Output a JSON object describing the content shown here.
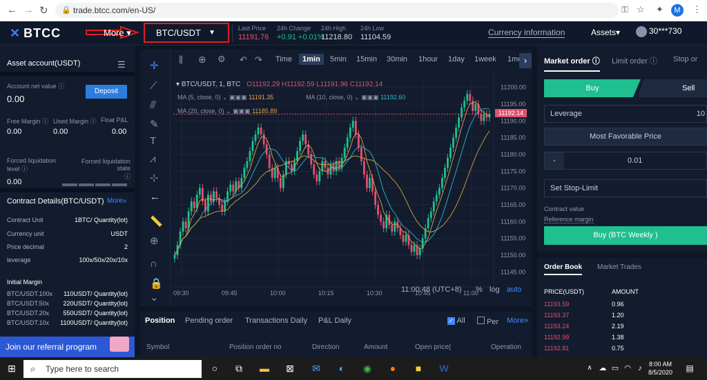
{
  "browser": {
    "url": "trade.btcc.com/en-US/",
    "profile_initial": "M"
  },
  "header": {
    "logo_text": "BTCC",
    "more_label": "More",
    "pair": "BTC/USDT",
    "last_price_label": "Last Price",
    "last_price": "11191.76",
    "change_label": "24h Change",
    "change": "+0.91 +0.01%",
    "high_label": "24h High",
    "high": "11218.80",
    "low_label": "24h Low",
    "low": "11104.59",
    "currency_info": "Currency information",
    "assets": "Assets",
    "user": "30***730"
  },
  "account": {
    "title": "Asset account(USDT)",
    "net_value_label": "Account net value",
    "net_value": "0.00",
    "deposit": "Deposit",
    "free_margin_label": "Free Margin",
    "free_margin": "0.00",
    "used_margin_label": "Used Margin",
    "used_margin": "0.00",
    "float_pl_label": "Float P&L",
    "float_pl": "0.00",
    "forced_liq_label": "Forced liquidation level",
    "forced_liq": "0.00",
    "forced_state_label": "Forced liquidation state"
  },
  "contract": {
    "title": "Contract Details(BTC/USDT)",
    "more": "More",
    "rows": [
      {
        "k": "Contract Unit",
        "v": "1BTC/ Quantity(lot)"
      },
      {
        "k": "Currency unit",
        "v": "USDT"
      },
      {
        "k": "Price decimal",
        "v": "2"
      },
      {
        "k": "leverage",
        "v": "100x/50x/20x/10x"
      }
    ],
    "initial_margin_label": "Initial Margin",
    "margins": [
      {
        "k": "BTC/USDT.100x",
        "v": "110USDT/ Quantity(lot)"
      },
      {
        "k": "BTC/USDT.50x",
        "v": "220USDT/ Quantity(lot)"
      },
      {
        "k": "BTC/USDT.20x",
        "v": "550USDT/ Quantity(lot)"
      },
      {
        "k": "BTC/USDT.10x",
        "v": "1100USDT/ Quantity(lot)"
      }
    ],
    "referral": "Join our referral program"
  },
  "chart": {
    "timeframes": [
      "Time",
      "1min",
      "5min",
      "15min",
      "30min",
      "1hour",
      "1day",
      "1week",
      "1mon"
    ],
    "active_tf": "1min",
    "legend_pair": "BTC/USDT, 1, BTC",
    "ohlc": "O11192.29 H11192.59 L11191.96 C11192.14",
    "ma5_label": "MA (5, close, 0)",
    "ma5": "11191.35",
    "ma10_label": "MA (10, close, 0)",
    "ma10": "11192.60",
    "ma20_label": "MA (20, close, 0)",
    "ma20": "11185.89",
    "current_price_tag": "11192.14",
    "time_readout": "11:00:48 (UTC+8)",
    "pct": "%",
    "log": "log",
    "auto": "auto"
  },
  "chart_data": {
    "type": "candlestick",
    "x_ticks": [
      "09:30",
      "09:45",
      "10:00",
      "10:15",
      "10:30",
      "10:45",
      "11:00"
    ],
    "y_ticks": [
      11200,
      11195,
      11190,
      11185,
      11180,
      11175,
      11170,
      11165,
      11160,
      11155,
      11150,
      11145
    ],
    "ylim": [
      11143,
      11203
    ],
    "close": [
      11150,
      11153,
      11157,
      11160,
      11158,
      11163,
      11166,
      11164,
      11168,
      11170,
      11166,
      11163,
      11168,
      11166,
      11169,
      11167,
      11165,
      11163,
      11166,
      11169,
      11171,
      11169,
      11172,
      11170,
      11173,
      11176,
      11178,
      11181,
      11184,
      11186,
      11188,
      11186,
      11183,
      11180,
      11176,
      11173,
      11176,
      11173,
      11170,
      11174,
      11178,
      11177,
      11175,
      11178,
      11181,
      11184,
      11186,
      11183,
      11180,
      11177,
      11174,
      11172,
      11175,
      11178,
      11176,
      11174,
      11177,
      11175,
      11178,
      11176,
      11179,
      11182,
      11185,
      11188,
      11190,
      11186,
      11182,
      11178,
      11174,
      11170,
      11173,
      11169,
      11165,
      11162,
      11160,
      11158,
      11162,
      11159,
      11157,
      11160,
      11158,
      11156,
      11154,
      11156,
      11153,
      11151,
      11153,
      11150,
      11152,
      11155,
      11158,
      11161,
      11163,
      11166,
      11168,
      11170,
      11173,
      11176,
      11179,
      11182,
      11185,
      11188,
      11191,
      11194,
      11196,
      11198,
      11196,
      11193,
      11195,
      11192,
      11190,
      11192,
      11191,
      11192
    ]
  },
  "bottom": {
    "tabs": [
      "Position",
      "Pending order",
      "Transactions Daily",
      "P&L Daily"
    ],
    "all": "All",
    "per": "Per",
    "more": "More",
    "cols": [
      "Symbol",
      "Position order no",
      "Direction",
      "Amount",
      "Open price(",
      "Operation"
    ]
  },
  "order": {
    "tabs": [
      "Market order",
      "Limit order",
      "Stop or"
    ],
    "buy": "Buy",
    "sell": "Sell",
    "leverage_label": "Leverage",
    "leverage_value": "10",
    "fav_price": "Most Favorable Price",
    "minus": "-",
    "qty": "0.01",
    "stop_limit": "Set Stop-Limit",
    "contract_value": "Contract value",
    "ref_margin": "Reference margin",
    "buy_weekly": "Buy (BTC Weekly )"
  },
  "orderbook": {
    "tabs": [
      "Order Book",
      "Market Trades"
    ],
    "price_col": "PRICE(USDT)",
    "amount_col": "AMOUNT",
    "rows": [
      {
        "p": "11193.59",
        "a": "0.96"
      },
      {
        "p": "11193.37",
        "a": "1.20"
      },
      {
        "p": "11193.24",
        "a": "2.19"
      },
      {
        "p": "11192.99",
        "a": "1.38"
      },
      {
        "p": "11192.81",
        "a": "0.75"
      }
    ]
  },
  "taskbar": {
    "search": "Type here to search",
    "time": "8:00 AM",
    "date": "8/5/2020"
  }
}
